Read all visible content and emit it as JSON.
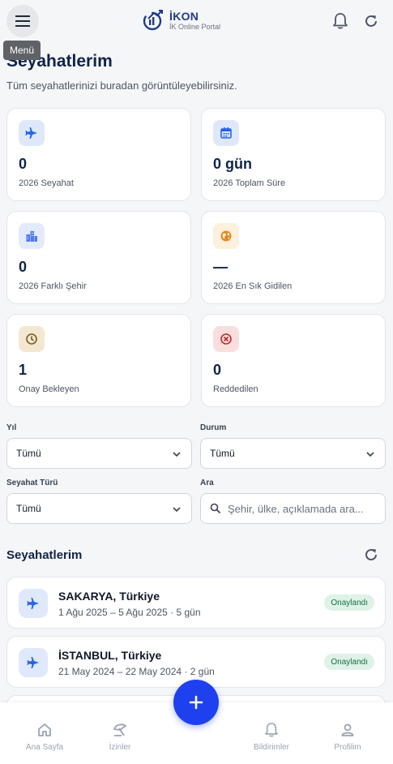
{
  "header": {
    "menu_tooltip": "Menü",
    "logo_name": "İKON",
    "logo_subtitle": "İK Online Portal",
    "icons": [
      "menu-icon",
      "bell-icon",
      "refresh-icon"
    ]
  },
  "page": {
    "title": "Seyahatlerim",
    "subtitle": "Tüm seyahatlerinizi buradan görüntüleyebilirsiniz."
  },
  "stats": [
    {
      "value": "0",
      "label": "2026 Seyahat",
      "icon": "plane-icon",
      "color": "#2563eb",
      "bg": "#dfe8fb"
    },
    {
      "value": "0 gün",
      "label": "2026 Toplam Süre",
      "icon": "calendar-icon",
      "color": "#2563eb",
      "bg": "#dfe8fb"
    },
    {
      "value": "0",
      "label": "2026 Farklı Şehir",
      "icon": "city-icon",
      "color": "#4f7be8",
      "bg": "#e3eafb"
    },
    {
      "value": "—",
      "label": "2026 En Sık Gidilen",
      "icon": "globe-icon",
      "color": "#e08a1e",
      "bg": "#fdf0dc"
    },
    {
      "value": "1",
      "label": "Onay Bekleyen",
      "icon": "clock-icon",
      "color": "#7a5a1c",
      "bg": "#f4e7d2"
    },
    {
      "value": "0",
      "label": "Reddedilen",
      "icon": "cancel-circle-icon",
      "color": "#c62828",
      "bg": "#f9dede"
    }
  ],
  "filters": {
    "year_label": "Yıl",
    "year_value": "Tümü",
    "status_label": "Durum",
    "status_value": "Tümü",
    "type_label": "Seyahat Türü",
    "type_value": "Tümü",
    "search_label": "Ara",
    "search_placeholder": "Şehir, ülke, açıklamada ara..."
  },
  "list": {
    "title": "Seyahatlerim",
    "trips": [
      {
        "city": "SAKARYA, Türkiye",
        "dates": "1 Ağu 2025 – 5 Ağu 2025 · 5 gün",
        "status": "Onaylandı"
      },
      {
        "city": "İSTANBUL, Türkiye",
        "dates": "21 May 2024 – 22 May 2024 · 2 gün",
        "status": "Onaylandı"
      }
    ]
  },
  "bottom_nav": [
    {
      "label": "Ana Sayfa",
      "icon": "home-icon"
    },
    {
      "label": "İzinler",
      "icon": "beach-icon"
    },
    {
      "label": "Bildirimler",
      "icon": "bell-icon"
    },
    {
      "label": "Profilim",
      "icon": "person-icon"
    }
  ],
  "colors": {
    "accent": "#1e40ef",
    "title": "#0f2347",
    "badge_bg": "#def2e8",
    "badge_text": "#15703f"
  }
}
